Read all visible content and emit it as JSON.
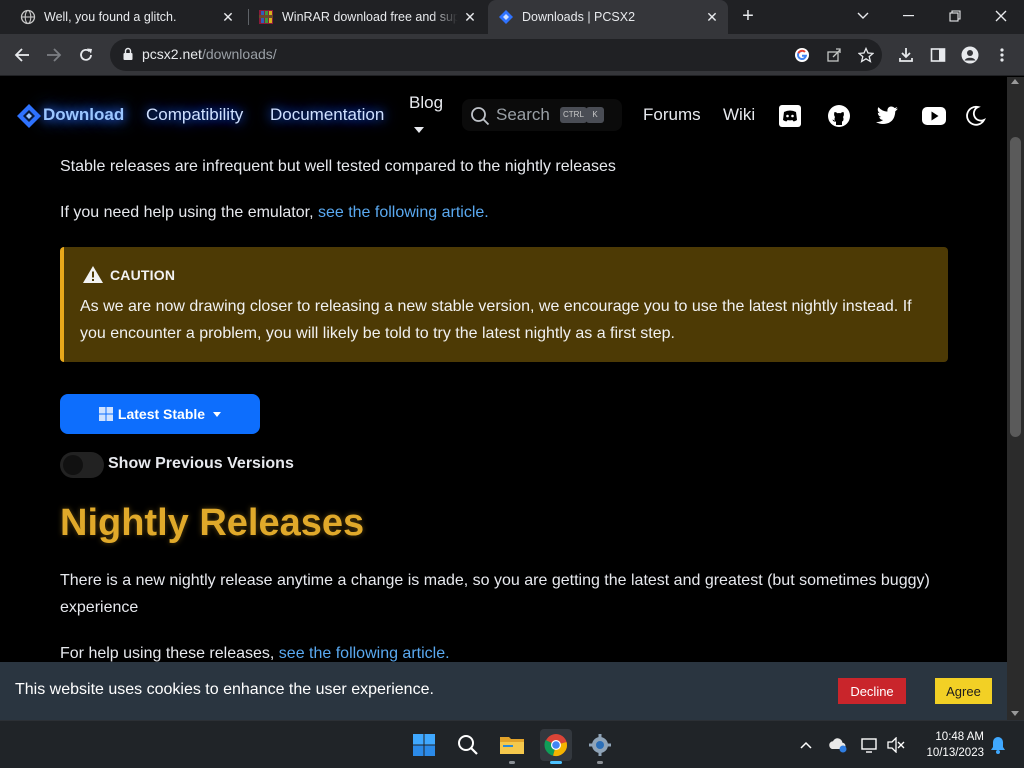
{
  "browser": {
    "tabs": [
      {
        "title": "Well, you found a glitch.",
        "close": "✕",
        "active": false
      },
      {
        "title": "WinRAR download free and supp",
        "close": "✕",
        "active": false
      },
      {
        "title": "Downloads | PCSX2",
        "close": "✕",
        "active": true
      }
    ],
    "new_tab": "+",
    "address": {
      "domain": "pcsx2.net",
      "path": "/downloads/"
    }
  },
  "site_nav": {
    "brand_label": "Download",
    "links": [
      "Compatibility",
      "Documentation",
      "Blog",
      "Forums",
      "Wiki"
    ],
    "search_label": "Search",
    "search_key_1": "CTRL",
    "search_key_2": "K"
  },
  "content": {
    "intro": "Stable releases are infrequent but well tested compared to the nightly releases",
    "help_prefix": "If you need help using the emulator,",
    "help_link": "see the following article.",
    "caution": {
      "heading": "CAUTION",
      "body": "As we are now drawing closer to releasing a new stable version, we encourage you to use the latest nightly instead. If you encounter a problem, you will likely be told to try the latest nightly as a first step."
    },
    "stable_button": "Latest Stable",
    "toggle_label": "Show Previous Versions",
    "toggle_on": false,
    "nightly_heading": "Nightly Releases",
    "nightly_intro": "There is a new nightly release anytime a change is made, so you are getting the latest and greatest (but sometimes buggy) experience",
    "nightly_help_prefix": "For help using these releases,",
    "nightly_help_link": "see the following article."
  },
  "cookie_banner": {
    "message": "This website uses cookies to enhance the user experience.",
    "decline": "Decline",
    "agree": "Agree"
  },
  "taskbar": {
    "time": "10:48 AM",
    "date": "10/13/2023"
  },
  "colors": {
    "accent_blue": "#0d6efd",
    "link_blue": "#5aa9f0",
    "caution_bg": "#4d3a05",
    "caution_border": "#e8a81b",
    "heading_gold": "#e0a92a",
    "decline_red": "#c9252b",
    "agree_yellow": "#f2d025"
  }
}
